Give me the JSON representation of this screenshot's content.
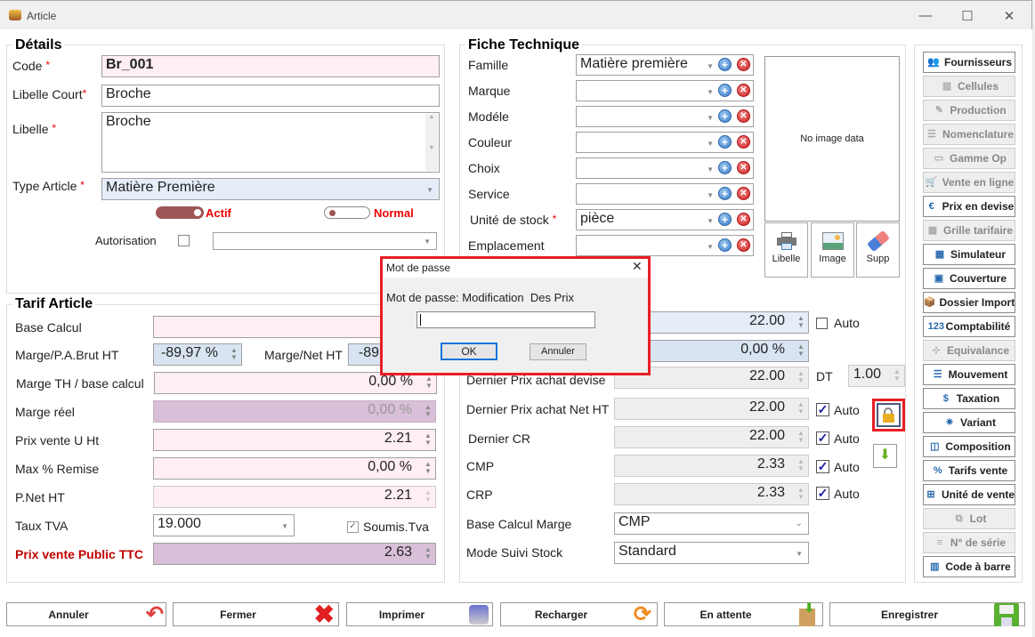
{
  "window": {
    "title": "Article",
    "controls": {
      "minimize": "—",
      "maximize": "☐",
      "close": "✕"
    }
  },
  "details": {
    "title": "Détails",
    "code": {
      "label": "Code",
      "value": "Br_001"
    },
    "libelle_court": {
      "label": "Libelle Court",
      "value": "Broche"
    },
    "libelle": {
      "label": "Libelle",
      "value": "Broche"
    },
    "type_article": {
      "label": "Type Article",
      "value": "Matière Première"
    },
    "actif": {
      "label": "Actif",
      "on": true
    },
    "normal": {
      "label": "Normal",
      "on": false
    },
    "autorisation": {
      "label": "Autorisation",
      "checked": false,
      "value": ""
    },
    "required_mark": "*"
  },
  "fiche": {
    "title": "Fiche Technique",
    "rows": [
      {
        "label": "Famille",
        "value": "Matière première"
      },
      {
        "label": "Marque",
        "value": ""
      },
      {
        "label": "Modéle",
        "value": ""
      },
      {
        "label": "Couleur",
        "value": ""
      },
      {
        "label": "Choix",
        "value": ""
      },
      {
        "label": "Service",
        "value": ""
      },
      {
        "label": "Unité de stock",
        "value": "pièce",
        "required": true
      },
      {
        "label": "Emplacement",
        "value": ""
      }
    ],
    "image": {
      "placeholder": "No image data",
      "buttons": [
        {
          "label": "Libelle",
          "icon": "printer-icon"
        },
        {
          "label": "Image",
          "icon": "image-icon"
        },
        {
          "label": "Supp",
          "icon": "eraser-icon"
        }
      ]
    }
  },
  "tarif": {
    "title": "Tarif Article",
    "base_calcul": {
      "label": "Base Calcul",
      "value": ""
    },
    "marge_pa_brut": {
      "label": "Marge/P.A.Brut HT",
      "value": "-89,97 %"
    },
    "marge_net": {
      "label": "Marge/Net HT",
      "value": "-89"
    },
    "marge_th": {
      "label": "Marge TH / base calcul",
      "value": "0,00 %"
    },
    "marge_reel": {
      "label": "Marge réel",
      "value": "0,00 %"
    },
    "prix_vente_u": {
      "label": "Prix vente U Ht",
      "value": "2.21"
    },
    "max_remise": {
      "label": "Max % Remise",
      "value": "0,00 %"
    },
    "pnet": {
      "label": "P.Net HT",
      "value": "2.21"
    },
    "tva": {
      "label": "Taux TVA",
      "value": "19.000"
    },
    "soumis_tva": {
      "label": "Soumis.Tva",
      "checked": true
    },
    "prix_public": {
      "label": "Prix vente Public TTC",
      "value": "2.63"
    }
  },
  "achat": {
    "row1": {
      "value": "22.00",
      "auto_label": "Auto",
      "auto": false
    },
    "row2": {
      "value": "0,00 %"
    },
    "dernier_devise": {
      "label": "Dernier Prix achat devise",
      "value": "22.00",
      "currency": "DT",
      "rate": "1.00"
    },
    "dernier_net": {
      "label": "Dernier Prix achat Net HT",
      "value": "22.00",
      "auto_label": "Auto",
      "auto": true
    },
    "dernier_cr": {
      "label": "Dernier CR",
      "value": "22.00",
      "auto_label": "Auto",
      "auto": true
    },
    "cmp": {
      "label": "CMP",
      "value": "2.33",
      "auto_label": "Auto",
      "auto": true
    },
    "crp": {
      "label": "CRP",
      "value": "2.33",
      "auto_label": "Auto",
      "auto": true
    },
    "base_marge": {
      "label": "Base Calcul Marge",
      "value": "CMP"
    },
    "mode_stock": {
      "label": "Mode Suivi Stock",
      "value": "Standard"
    }
  },
  "sidebar": [
    {
      "label": "Fournisseurs",
      "icon": "suppliers-icon",
      "enabled": true
    },
    {
      "label": "Cellules",
      "icon": "bar-chart-icon",
      "enabled": false
    },
    {
      "label": "Production",
      "icon": "production-icon",
      "enabled": false
    },
    {
      "label": "Nomenclature",
      "icon": "list-icon",
      "enabled": false
    },
    {
      "label": "Gamme Op",
      "icon": "window-icon",
      "enabled": false
    },
    {
      "label": "Vente en ligne",
      "icon": "cart-icon",
      "enabled": false
    },
    {
      "label": "Prix en devise",
      "icon": "currency-icon",
      "enabled": true
    },
    {
      "label": "Grille tarifaire",
      "icon": "grid-icon",
      "enabled": false
    },
    {
      "label": "Simulateur",
      "icon": "calculator-icon",
      "enabled": true
    },
    {
      "label": "Couverture",
      "icon": "coverage-icon",
      "enabled": true
    },
    {
      "label": "Dossier Import",
      "icon": "package-icon",
      "enabled": true
    },
    {
      "label": "Comptabilité",
      "icon": "numbers-icon",
      "enabled": true
    },
    {
      "label": "Equivalance",
      "icon": "equivalence-icon",
      "enabled": false
    },
    {
      "label": "Mouvement",
      "icon": "movement-icon",
      "enabled": true
    },
    {
      "label": "Taxation",
      "icon": "tax-icon",
      "enabled": true
    },
    {
      "label": "Variant",
      "icon": "variant-icon",
      "enabled": true
    },
    {
      "label": "Composition",
      "icon": "composition-icon",
      "enabled": true
    },
    {
      "label": "Tarifs vente",
      "icon": "percent-icon",
      "enabled": true
    },
    {
      "label": "Unité de vente",
      "icon": "unit-icon",
      "enabled": true
    },
    {
      "label": "Lot",
      "icon": "lot-icon",
      "enabled": false
    },
    {
      "label": "N° de série",
      "icon": "serial-icon",
      "enabled": false
    },
    {
      "label": "Code à barre",
      "icon": "barcode-icon",
      "enabled": true
    }
  ],
  "footer": {
    "annuler": "Annuler",
    "fermer": "Fermer",
    "imprimer": "Imprimer",
    "recharger": "Recharger",
    "en_attente": "En attente",
    "enregistrer": "Enregistrer"
  },
  "dialog": {
    "title": "Mot de passe",
    "prompt": "Mot de passe: Modification  Des Prix",
    "password": "",
    "ok": "OK",
    "cancel": "Annuler"
  },
  "colors": {
    "accent_red": "#e81e25",
    "toggle": "#9e5555",
    "label_red": "#c00000"
  }
}
